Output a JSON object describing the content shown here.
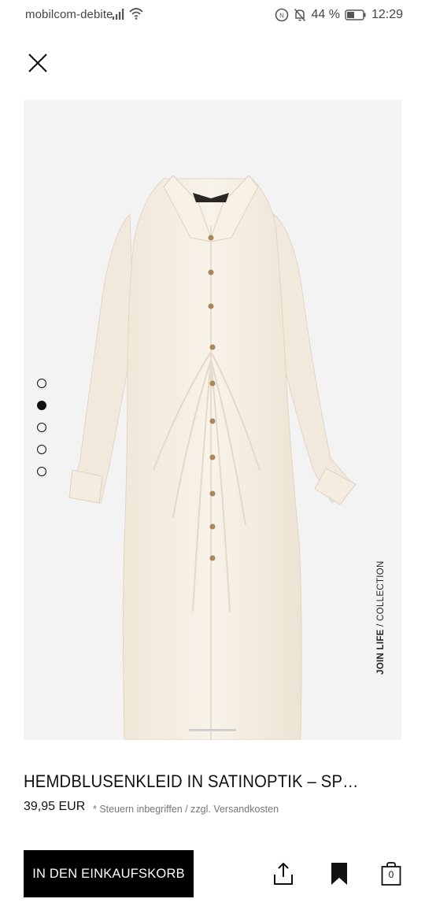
{
  "status_bar": {
    "carrier": "mobilcom-debite",
    "battery": "44 %",
    "time": "12:29",
    "icons": [
      "signal-icon",
      "wifi-icon",
      "nfc-icon",
      "mute-bell-icon",
      "battery-icon"
    ]
  },
  "gallery": {
    "image_alt": "shirt dress product photo",
    "dots_count": 5,
    "active_dot": 1,
    "badge_bold": "JOIN LIFE",
    "badge_rest": " / COLLECTION"
  },
  "product": {
    "title": "HEMDBLUSENKLEID IN SATINOPTIK – SP…",
    "price": "39,95 EUR",
    "tax_note": "* Steuern inbegriffen / zzgl. Versandkosten"
  },
  "actions": {
    "add_to_cart": "IN DEN EINKAUFSKORB",
    "bag_count": "0"
  },
  "colors": {
    "background": "#ffffff",
    "image_background": "#f3f3f3",
    "dress": "#f5efe3",
    "button": "#000000",
    "text": "#111111"
  }
}
